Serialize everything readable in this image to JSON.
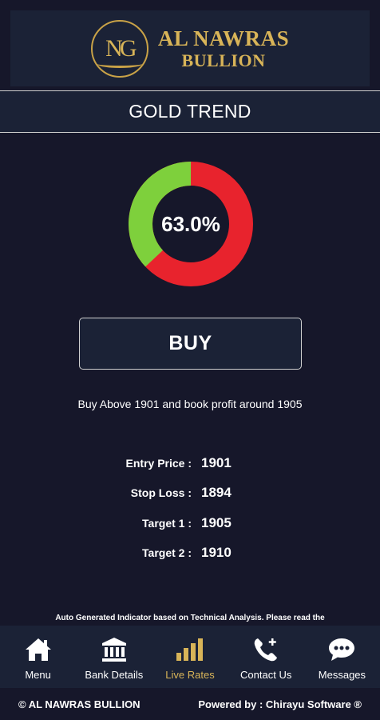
{
  "brand": {
    "monogram": "NG",
    "name_line1": "AL NAWRAS",
    "name_line2": "BULLION",
    "gold": "#d8b458"
  },
  "page_title": "GOLD TREND",
  "trend": {
    "percent_label": "63.0%",
    "percent": 63.0,
    "colors": {
      "red": "#e8232d",
      "green": "#7ed03c"
    }
  },
  "signal": {
    "label": "BUY"
  },
  "advice": "Buy Above 1901 and book profit around 1905",
  "stats": [
    {
      "label": "Entry Price :",
      "value": "1901"
    },
    {
      "label": "Stop Loss :",
      "value": "1894"
    },
    {
      "label": "Target 1 :",
      "value": "1905"
    },
    {
      "label": "Target 2 :",
      "value": "1910"
    }
  ],
  "disclaimer": "Auto Generated Indicator based on Technical Analysis. Please read the",
  "nav": [
    {
      "label": "Menu",
      "icon": "home-icon"
    },
    {
      "label": "Bank Details",
      "icon": "bank-icon"
    },
    {
      "label": "Live Rates",
      "icon": "bar-chart-icon",
      "active": true
    },
    {
      "label": "Contact Us",
      "icon": "phone-icon"
    },
    {
      "label": "Messages",
      "icon": "chat-bubble-icon"
    }
  ],
  "footer": {
    "left": "© AL NAWRAS BULLION",
    "right": "Powered by : Chirayu Software ®"
  }
}
